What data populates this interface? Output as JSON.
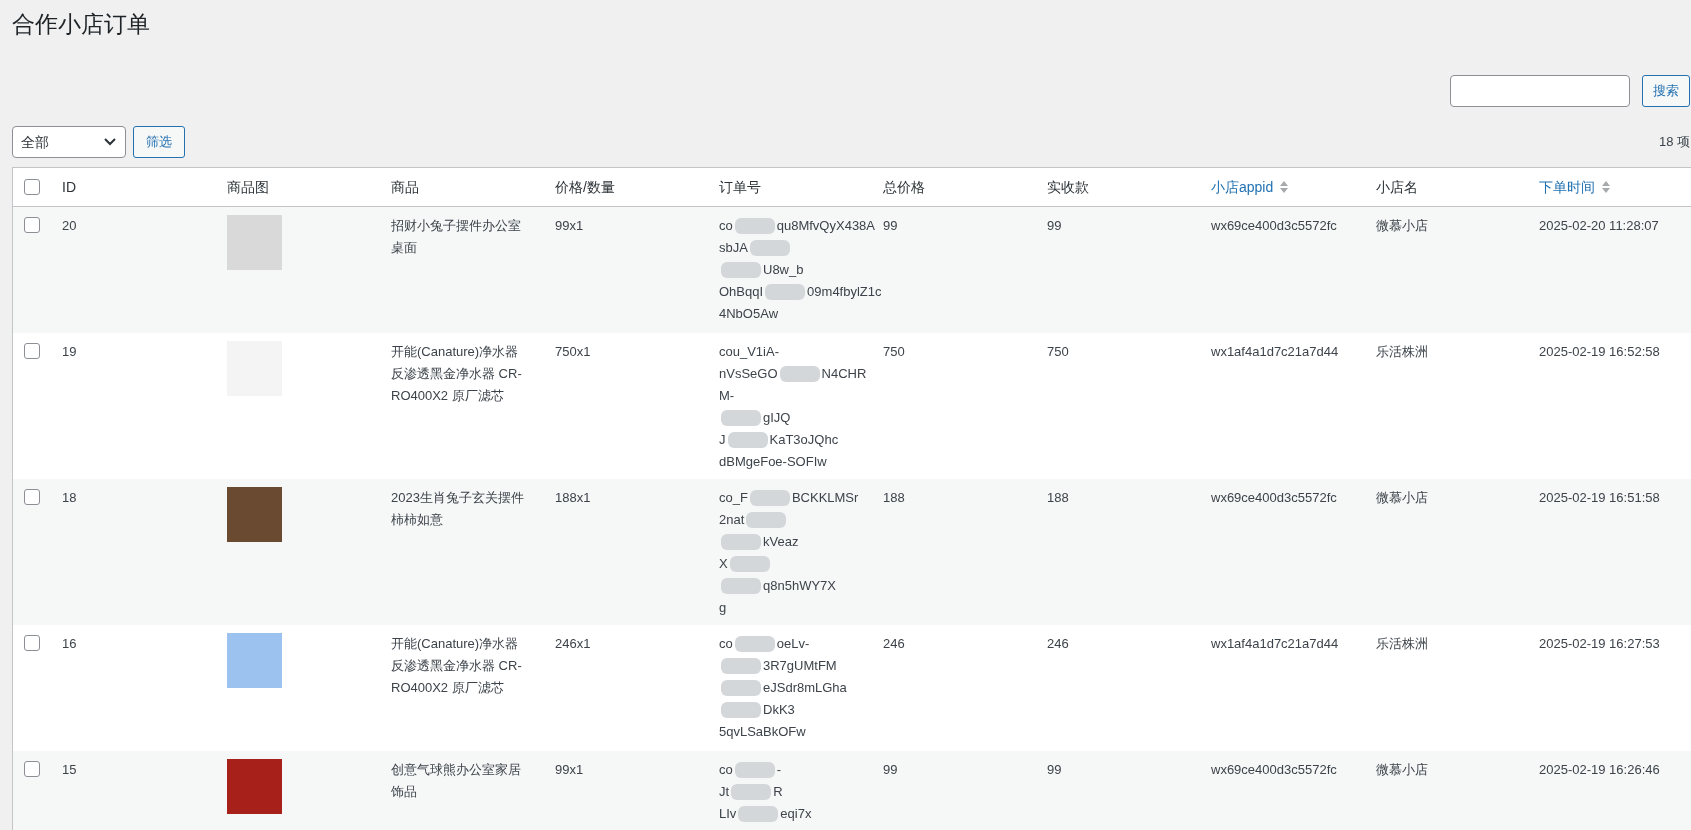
{
  "page_title": "合作小店订单",
  "search": {
    "button": "搜索"
  },
  "filter": {
    "select_value": "全部",
    "button": "筛选"
  },
  "item_count": "18 项",
  "table": {
    "header_checkbox": {
      "checked": false
    },
    "columns": [
      {
        "label": "ID",
        "sortable": false
      },
      {
        "label": "商品图",
        "sortable": false
      },
      {
        "label": "商品",
        "sortable": false
      },
      {
        "label": "价格/数量",
        "sortable": false
      },
      {
        "label": "订单号",
        "sortable": false
      },
      {
        "label": "总价格",
        "sortable": false
      },
      {
        "label": "实收款",
        "sortable": false
      },
      {
        "label": "小店appid",
        "sortable": true
      },
      {
        "label": "小店名",
        "sortable": false
      },
      {
        "label": "下单时间",
        "sortable": true
      }
    ],
    "rows": [
      {
        "checked": false,
        "id": "20",
        "product": "招财小兔子摆件办公室桌面",
        "price_qty": "99x1",
        "order_lines": [
          [
            {
              "kind": "text",
              "text": "co"
            },
            {
              "kind": "redacted"
            },
            {
              "kind": "text",
              "text": "qu8MfvQyX438A"
            }
          ],
          [
            {
              "kind": "text",
              "text": "sbJA"
            },
            {
              "kind": "redacted"
            }
          ],
          [
            {
              "kind": "redacted"
            },
            {
              "kind": "text",
              "text": "U8w_b"
            }
          ],
          [
            {
              "kind": "text",
              "text": "OhBqqI"
            },
            {
              "kind": "redacted"
            },
            {
              "kind": "text",
              "text": "09m4fbylZ1c"
            }
          ],
          [
            {
              "kind": "text",
              "text": "4NbO5Aw"
            }
          ]
        ],
        "total": "99",
        "paid": "99",
        "appid": "wx69ce400d3c5572fc",
        "shop": "微慕小店",
        "time": "2025-02-20 11:28:07"
      },
      {
        "checked": false,
        "id": "19",
        "product": "开能(Canature)净水器反渗透黑金净水器 CR-RO400X2 原厂滤芯",
        "price_qty": "750x1",
        "order_lines": [
          [
            {
              "kind": "text",
              "text": "cou_V1iA-"
            }
          ],
          [
            {
              "kind": "text",
              "text": "nVsSeGO"
            },
            {
              "kind": "redacted"
            },
            {
              "kind": "text",
              "text": "N4CHR"
            }
          ],
          [
            {
              "kind": "text",
              "text": "M-"
            }
          ],
          [
            {
              "kind": "redacted"
            },
            {
              "kind": "text",
              "text": "gIJQ"
            }
          ],
          [
            {
              "kind": "text",
              "text": "J"
            },
            {
              "kind": "redacted"
            },
            {
              "kind": "text",
              "text": "KaT3oJQhc"
            }
          ],
          [
            {
              "kind": "text",
              "text": "dBMgeFoe-SOFIw"
            }
          ]
        ],
        "total": "750",
        "paid": "750",
        "appid": "wx1af4a1d7c21a7d44",
        "shop": "乐活株洲",
        "time": "2025-02-19 16:52:58"
      },
      {
        "checked": false,
        "id": "18",
        "product": "2023生肖兔子玄关摆件柿柿如意",
        "price_qty": "188x1",
        "order_lines": [
          [
            {
              "kind": "text",
              "text": "co_F"
            },
            {
              "kind": "redacted"
            },
            {
              "kind": "text",
              "text": "BCKKLMSr"
            }
          ],
          [
            {
              "kind": "text",
              "text": "2nat"
            },
            {
              "kind": "redacted"
            }
          ],
          [
            {
              "kind": "redacted"
            },
            {
              "kind": "text",
              "text": "kVeaz"
            }
          ],
          [
            {
              "kind": "text",
              "text": "X"
            },
            {
              "kind": "redacted"
            }
          ],
          [
            {
              "kind": "redacted"
            },
            {
              "kind": "text",
              "text": "q8n5hWY7X"
            }
          ],
          [
            {
              "kind": "text",
              "text": "g"
            }
          ]
        ],
        "total": "188",
        "paid": "188",
        "appid": "wx69ce400d3c5572fc",
        "shop": "微慕小店",
        "time": "2025-02-19 16:51:58"
      },
      {
        "checked": false,
        "id": "16",
        "product": "开能(Canature)净水器反渗透黑金净水器 CR-RO400X2 原厂滤芯",
        "price_qty": "246x1",
        "order_lines": [
          [
            {
              "kind": "text",
              "text": "co"
            },
            {
              "kind": "redacted"
            },
            {
              "kind": "text",
              "text": "oeLv-"
            }
          ],
          [
            {
              "kind": "redacted"
            },
            {
              "kind": "text",
              "text": "3R7gUMtFM"
            }
          ],
          [
            {
              "kind": "redacted"
            },
            {
              "kind": "text",
              "text": "eJSdr8mLGha"
            }
          ],
          [
            {
              "kind": "redacted"
            },
            {
              "kind": "text",
              "text": "DkK3"
            }
          ],
          [
            {
              "kind": "text",
              "text": "5qvLSaBkOFw"
            }
          ]
        ],
        "total": "246",
        "paid": "246",
        "appid": "wx1af4a1d7c21a7d44",
        "shop": "乐活株洲",
        "time": "2025-02-19 16:27:53"
      },
      {
        "checked": false,
        "id": "15",
        "product": "创意气球熊办公室家居饰品",
        "price_qty": "99x1",
        "order_lines": [
          [
            {
              "kind": "text",
              "text": "co"
            },
            {
              "kind": "redacted"
            },
            {
              "kind": "text",
              "text": "-"
            }
          ],
          [
            {
              "kind": "text",
              "text": "Jt"
            },
            {
              "kind": "redacted"
            },
            {
              "kind": "text",
              "text": "R"
            }
          ],
          [
            {
              "kind": "text",
              "text": "LIv"
            },
            {
              "kind": "redacted"
            },
            {
              "kind": "text",
              "text": "eqi7x"
            }
          ]
        ],
        "total": "99",
        "paid": "99",
        "appid": "wx69ce400d3c5572fc",
        "shop": "微慕小店",
        "time": "2025-02-19 16:26:46"
      }
    ]
  }
}
